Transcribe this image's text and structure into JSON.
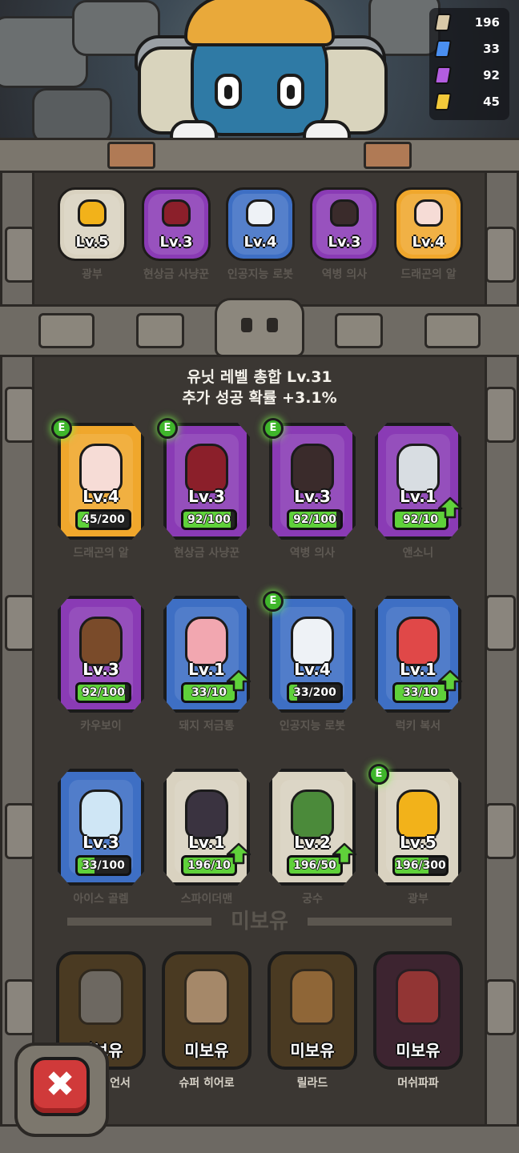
{
  "resources": [
    {
      "name": "stone-icon",
      "value": "196",
      "color": "#d9c9a8"
    },
    {
      "name": "blue-crystal-icon",
      "value": "33",
      "color": "#4a8ff0"
    },
    {
      "name": "purple-crystal-icon",
      "value": "92",
      "color": "#b35de0"
    },
    {
      "name": "gold-crystal-icon",
      "value": "45",
      "color": "#f2c93a"
    }
  ],
  "equipped": [
    {
      "level": "Lv.5",
      "name": "광부",
      "tier_color": "#d9d2c0",
      "char_color": "#f2b21a"
    },
    {
      "level": "Lv.3",
      "name": "현상금 사냥꾼",
      "tier_color": "#8a3bb5",
      "char_color": "#8b1f2a"
    },
    {
      "level": "Lv.4",
      "name": "인공지능 로봇",
      "tier_color": "#3e6fc4",
      "char_color": "#eef2f6"
    },
    {
      "level": "Lv.3",
      "name": "역병 의사",
      "tier_color": "#8a3bb5",
      "char_color": "#3a2b2b"
    },
    {
      "level": "Lv.4",
      "name": "드래곤의 알",
      "tier_color": "#f0a72c",
      "char_color": "#f6dcd6"
    }
  ],
  "stats": {
    "total_level": "유닛 레벨 총합 Lv.31",
    "bonus_chance": "추가 성공 확률 +3.1%"
  },
  "units": [
    {
      "name": "드래곤의 알",
      "level": "Lv.4",
      "progress": "45/200",
      "fill": 0.22,
      "tier_color": "#f0a72c",
      "char_color": "#f6dcd6",
      "equipped_badge": "E",
      "upgrade": false
    },
    {
      "name": "현상금 사냥꾼",
      "level": "Lv.3",
      "progress": "92/100",
      "fill": 0.92,
      "tier_color": "#8a3bb5",
      "char_color": "#8b1f2a",
      "equipped_badge": "E",
      "upgrade": false
    },
    {
      "name": "역병 의사",
      "level": "Lv.3",
      "progress": "92/100",
      "fill": 0.92,
      "tier_color": "#8a3bb5",
      "char_color": "#3a2b2b",
      "equipped_badge": "E",
      "upgrade": false
    },
    {
      "name": "앤소니",
      "level": "Lv.1",
      "progress": "92/10",
      "fill": 1.0,
      "tier_color": "#8a3bb5",
      "char_color": "#d8dde2",
      "equipped_badge": "",
      "upgrade": true
    },
    {
      "name": "카우보이",
      "level": "Lv.3",
      "progress": "92/100",
      "fill": 0.92,
      "tier_color": "#8a3bb5",
      "char_color": "#7a4b2a",
      "equipped_badge": "",
      "upgrade": false
    },
    {
      "name": "돼지 저금통",
      "level": "Lv.1",
      "progress": "33/10",
      "fill": 1.0,
      "tier_color": "#3e6fc4",
      "char_color": "#f2a7b0",
      "equipped_badge": "",
      "upgrade": true
    },
    {
      "name": "인공지능 로봇",
      "level": "Lv.4",
      "progress": "33/200",
      "fill": 0.16,
      "tier_color": "#3e6fc4",
      "char_color": "#eef2f6",
      "equipped_badge": "E",
      "upgrade": false
    },
    {
      "name": "럭키 복서",
      "level": "Lv.1",
      "progress": "33/10",
      "fill": 1.0,
      "tier_color": "#3e6fc4",
      "char_color": "#e04848",
      "equipped_badge": "",
      "upgrade": true
    },
    {
      "name": "아이스 골렘",
      "level": "Lv.3",
      "progress": "33/100",
      "fill": 0.33,
      "tier_color": "#3e6fc4",
      "char_color": "#cfe6f5",
      "equipped_badge": "",
      "upgrade": false
    },
    {
      "name": "스파이더맨",
      "level": "Lv.1",
      "progress": "196/10",
      "fill": 1.0,
      "tier_color": "#d9d2c0",
      "char_color": "#3a3340",
      "equipped_badge": "",
      "upgrade": true
    },
    {
      "name": "궁수",
      "level": "Lv.2",
      "progress": "196/50",
      "fill": 1.0,
      "tier_color": "#d9d2c0",
      "char_color": "#4b8a3a",
      "equipped_badge": "",
      "upgrade": true
    },
    {
      "name": "광부",
      "level": "Lv.5",
      "progress": "196/300",
      "fill": 0.65,
      "tier_color": "#d9d2c0",
      "char_color": "#f2b21a",
      "equipped_badge": "E",
      "upgrade": false
    }
  ],
  "unowned": {
    "title": "미보유",
    "cards": [
      {
        "label": "미보유",
        "name": "언서",
        "bg": "#4a3a22",
        "char_color": "#8a8f96"
      },
      {
        "label": "미보유",
        "name": "슈퍼 히어로",
        "bg": "#4a3a22",
        "char_color": "#f1c9a5"
      },
      {
        "label": "미보유",
        "name": "릴라드",
        "bg": "#4a3a22",
        "char_color": "#c98a4a"
      },
      {
        "label": "미보유",
        "name": "머쉬파파",
        "bg": "#3d2430",
        "char_color": "#d9443a"
      }
    ]
  },
  "close": {
    "label": "✖"
  }
}
